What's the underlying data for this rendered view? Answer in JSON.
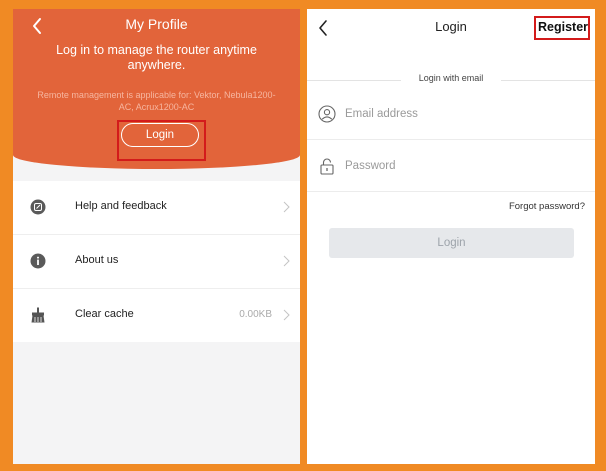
{
  "profile": {
    "title": "My Profile",
    "message": "Log in to manage the router anytime anywhere.",
    "note": "Remote management is applicable for: Vektor, Nebula1200-AC, Acrux1200-AC",
    "login_label": "Login",
    "menu": [
      {
        "label": "Help and feedback",
        "icon": "feedback-icon"
      },
      {
        "label": "About us",
        "icon": "info-icon"
      },
      {
        "label": "Clear cache",
        "icon": "broom-icon",
        "value": "0.00KB"
      }
    ]
  },
  "login": {
    "title": "Login",
    "register_label": "Register",
    "divider_text": "Login with email",
    "email_placeholder": "Email address",
    "password_placeholder": "Password",
    "forgot_label": "Forgot password?",
    "login_button": "Login"
  },
  "colors": {
    "frame": "#f08a24",
    "header": "#e2643a",
    "highlight": "#d31b1b",
    "disabled_button": "#e6e8eb"
  }
}
